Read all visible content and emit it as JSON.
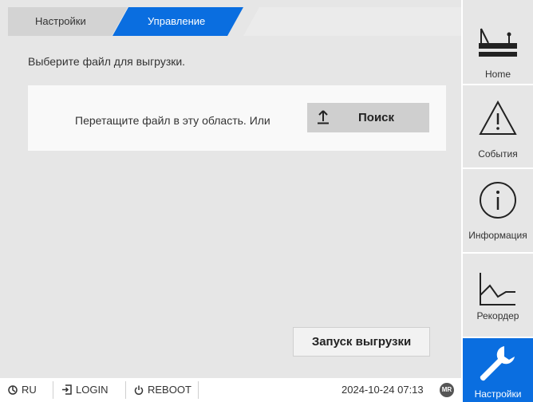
{
  "tabs": {
    "settings_label": "Настройки",
    "management_label": "Управление"
  },
  "main": {
    "instruction": "Выберите файл для выгрузки.",
    "drop_text": "Перетащите файл в эту область. Или",
    "search_label": "Поиск",
    "start_label": "Запуск выгрузки"
  },
  "sidebar": {
    "items": [
      {
        "label": "Home",
        "icon": "transformer-icon"
      },
      {
        "label": "События",
        "icon": "warning-icon"
      },
      {
        "label": "Информация",
        "icon": "info-icon"
      },
      {
        "label": "Рекордер",
        "icon": "recorder-icon"
      },
      {
        "label": "Настройки",
        "icon": "wrench-icon"
      }
    ]
  },
  "bottombar": {
    "language": "RU",
    "login": "LOGIN",
    "reboot": "REBOOT",
    "datetime": "2024-10-24 07:13",
    "badge": "MR"
  },
  "colors": {
    "accent": "#0a6ee0",
    "panel": "#e6e6e6"
  }
}
